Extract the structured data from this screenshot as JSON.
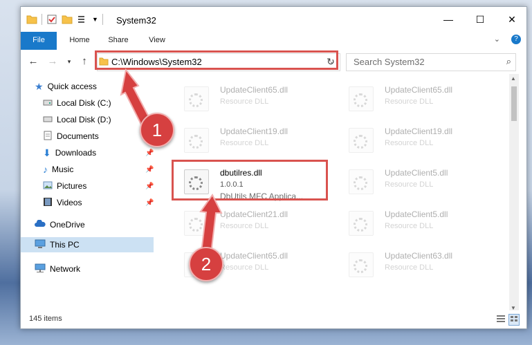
{
  "window": {
    "title": "System32",
    "controls": [
      "—",
      "☐",
      "✕"
    ]
  },
  "ribbon": {
    "tabs": [
      {
        "label": "File"
      },
      {
        "label": "Home"
      },
      {
        "label": "Share"
      },
      {
        "label": "View"
      }
    ]
  },
  "address": {
    "path": "C:\\Windows\\System32",
    "search_placeholder": "Search System32"
  },
  "nav": {
    "items": [
      {
        "label": "Quick access",
        "icon": "star-icon"
      },
      {
        "label": "Local Disk (C:)",
        "icon": "drive-icon"
      },
      {
        "label": "Local Disk (D:)",
        "icon": "drive-icon"
      },
      {
        "label": "Documents",
        "icon": "documents-icon"
      },
      {
        "label": "Downloads",
        "icon": "download-icon"
      },
      {
        "label": "Music",
        "icon": "music-icon"
      },
      {
        "label": "Pictures",
        "icon": "pictures-icon"
      },
      {
        "label": "Videos",
        "icon": "videos-icon"
      },
      {
        "label": "OneDrive",
        "icon": "cloud-icon"
      },
      {
        "label": "This PC",
        "icon": "computer-icon"
      },
      {
        "label": "Network",
        "icon": "network-icon"
      }
    ]
  },
  "files": [
    {
      "name": "UpdateClient65.dll",
      "type": "Resource DLL"
    },
    {
      "name": "UpdateClient65.dll",
      "type": "Resource DLL"
    },
    {
      "name": "UpdateClient19.dll",
      "type": "Resource DLL"
    },
    {
      "name": "UpdateClient19.dll",
      "type": "Resource DLL"
    },
    {
      "name": "dbutilres.dll",
      "type": "1.0.0.1",
      "desc": "DbUtils MFC Applica..."
    },
    {
      "name": "UpdateClient5.dll",
      "type": "Resource DLL"
    },
    {
      "name": "UpdateClient21.dll",
      "type": "Resource DLL"
    },
    {
      "name": "UpdateClient5.dll",
      "type": "Resource DLL"
    },
    {
      "name": "UpdateClient65.dll",
      "type": "Resource DLL"
    },
    {
      "name": "UpdateClient63.dll",
      "type": "Resource DLL"
    }
  ],
  "status": {
    "items_count": "145 items"
  },
  "annotations": {
    "badge1": "1",
    "badge2": "2",
    "highlight_color": "#d9534f"
  }
}
